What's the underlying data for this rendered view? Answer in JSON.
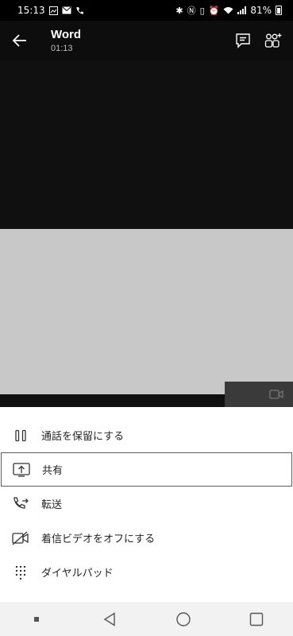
{
  "status_bar": {
    "time": "15:13",
    "battery": "81%"
  },
  "app_bar": {
    "title": "Word",
    "timer": "01:13"
  },
  "menu": {
    "items": [
      {
        "label": "通話を保留にする",
        "icon": "pause-icon"
      },
      {
        "label": "共有",
        "icon": "share-screen-icon",
        "highlighted": true
      },
      {
        "label": "転送",
        "icon": "transfer-call-icon"
      },
      {
        "label": "着信ビデオをオフにする",
        "icon": "video-off-icon"
      },
      {
        "label": "ダイヤルパッド",
        "icon": "dialpad-icon"
      }
    ]
  },
  "colors": {
    "highlight_border": "#d9262b",
    "sheet_bg": "#ffffff",
    "shared_screen_bg": "#c8c8c8"
  }
}
